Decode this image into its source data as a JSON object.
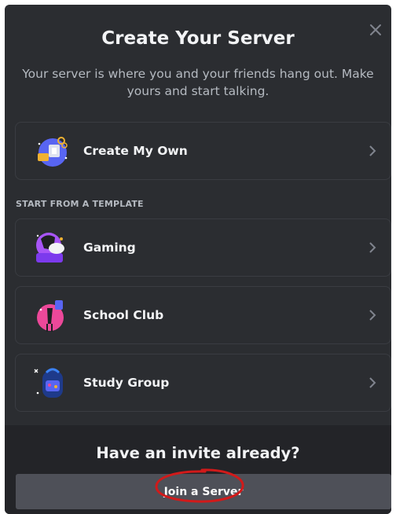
{
  "modal": {
    "title": "Create Your Server",
    "subtitle": "Your server is where you and your friends hang out. Make yours and start talking.",
    "close_icon": "close-icon"
  },
  "create_own": {
    "label": "Create My Own",
    "icon": "create-server-illustration-icon"
  },
  "template_section": {
    "header": "START FROM A TEMPLATE",
    "items": [
      {
        "label": "Gaming",
        "icon": "gaming-illustration-icon"
      },
      {
        "label": "School Club",
        "icon": "school-club-illustration-icon"
      },
      {
        "label": "Study Group",
        "icon": "study-group-illustration-icon"
      }
    ]
  },
  "footer": {
    "title": "Have an invite already?",
    "join_button_label": "Join a Server"
  },
  "colors": {
    "modal_bg": "#2b2d31",
    "footer_bg": "#232428",
    "button_bg": "#4e5058",
    "annotation": "#d11a1a"
  }
}
